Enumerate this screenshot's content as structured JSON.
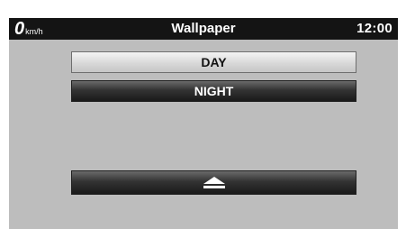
{
  "status_bar": {
    "speed_value": "0",
    "speed_unit": "km/h",
    "title": "Wallpaper",
    "clock": "12:00"
  },
  "options": {
    "day_label": "DAY",
    "night_label": "NIGHT",
    "selected": "NIGHT"
  },
  "eject_button": {
    "icon": "eject-icon"
  },
  "colors": {
    "background": "#bdbdbd",
    "status_bar": "#141414",
    "day_button": "#d8d8d8",
    "night_button": "#333333"
  }
}
